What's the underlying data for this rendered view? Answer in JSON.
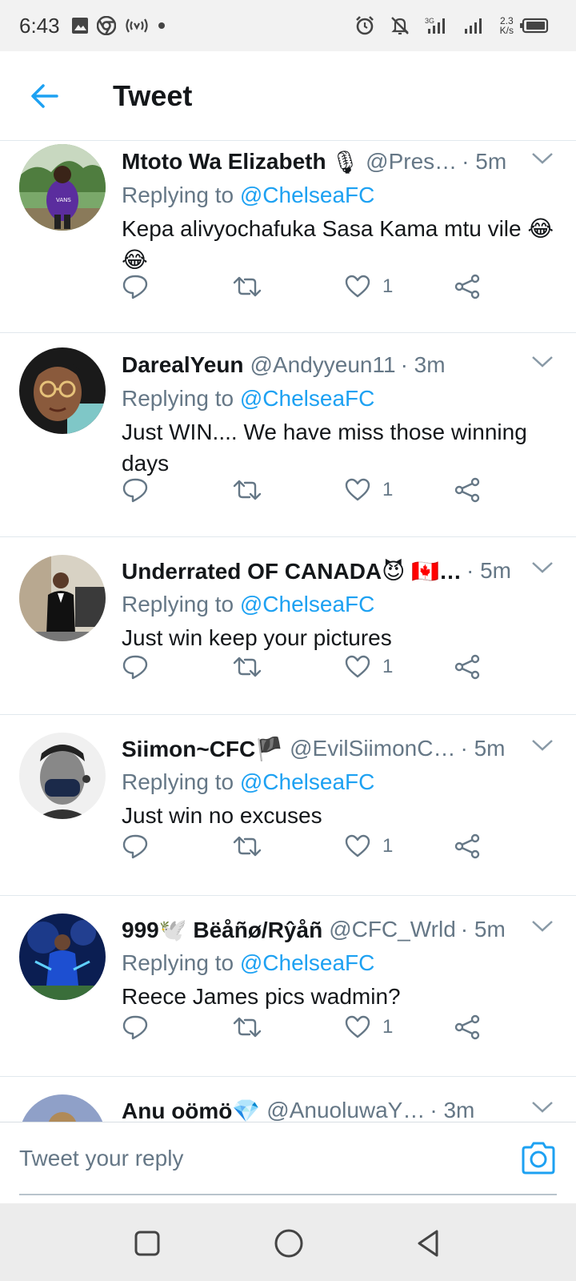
{
  "status_bar": {
    "time": "6:43",
    "speed_value": "2.3",
    "speed_unit": "K/s"
  },
  "header": {
    "title": "Tweet"
  },
  "tweets": [
    {
      "name": "Mtoto Wa Elizabeth",
      "name_emoji": "🎙",
      "handle": "@Pres…",
      "time": "· 5m",
      "reply_prefix": "Replying to",
      "mention": "@ChelseaFC",
      "text": "Kepa alivyochafuka Sasa Kama mtu vile 😂😂",
      "like_count": "1"
    },
    {
      "name": "DarealYeun",
      "name_emoji": "",
      "handle": "@Andyyeun11",
      "time": "· 3m",
      "reply_prefix": "Replying to",
      "mention": "@ChelseaFC",
      "text": "Just WIN.... We have miss those winning days",
      "like_count": "1"
    },
    {
      "name": "Underrated OF CANADA😈 🇨🇦…",
      "name_emoji": "",
      "handle": "",
      "time": "· 5m",
      "reply_prefix": "Replying to",
      "mention": "@ChelseaFC",
      "text": "Just win keep your pictures",
      "like_count": "1"
    },
    {
      "name": "Siimon~CFC🏴",
      "name_emoji": "",
      "handle": "@EvilSiimonC…",
      "time": "· 5m",
      "reply_prefix": "Replying to",
      "mention": "@ChelseaFC",
      "text": "Just win no excuses",
      "like_count": "1"
    },
    {
      "name": "999🕊️ Bëåñø/Rŷåñ",
      "name_emoji": "",
      "handle": "@CFC_Wrld",
      "time": "· 5m",
      "reply_prefix": "Replying to",
      "mention": "@ChelseaFC",
      "text": "Reece James pics wadmin?",
      "like_count": "1"
    },
    {
      "name": "Anu oömö💎",
      "name_emoji": "",
      "handle": "@AnuoluwaY…",
      "time": "· 3m",
      "reply_prefix": "",
      "mention": "",
      "text": "",
      "like_count": ""
    }
  ],
  "reply_bar": {
    "placeholder": "Tweet your reply"
  },
  "colors": {
    "accent": "#1da1f2",
    "muted": "#657786",
    "text": "#14171a",
    "divider": "#e1e8ed"
  },
  "icons": {
    "back": "arrow-left-icon",
    "reply": "comment-bubble-icon",
    "retweet": "retweet-icon",
    "like": "heart-outline-icon",
    "share": "share-nodes-icon",
    "camera": "camera-icon",
    "caret": "chevron-down-icon",
    "nav_recents": "square-icon",
    "nav_home": "circle-icon",
    "nav_back": "triangle-back-icon"
  }
}
